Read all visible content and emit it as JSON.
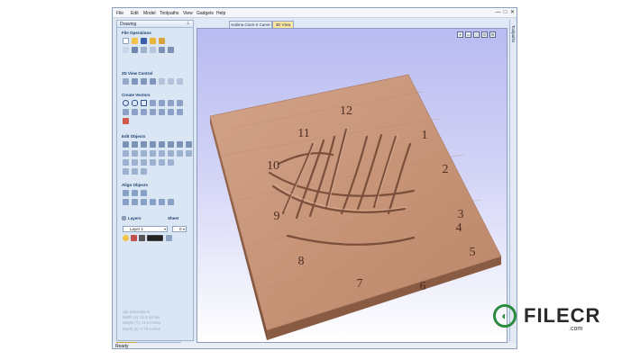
{
  "menu": [
    "File",
    "Edit",
    "Model",
    "Toolpaths",
    "View",
    "Gadgets",
    "Help"
  ],
  "window_controls": [
    "—",
    "□",
    "✕"
  ],
  "panel": {
    "title": "Drawing",
    "pin": "⊥",
    "sections": {
      "file_operations": "File Operations",
      "view_control": "2D View Control",
      "create_vectors": "Create Vectors",
      "edit_objects": "Edit Objects",
      "align_objects": "Align Objects"
    },
    "layers_label": "Layers",
    "sheet_label": "Sheet",
    "layer_select": "Layer 1",
    "sheet_select": "0",
    "job_dims_title": "Job Dimensions",
    "job_width": "Width  (X): 11.8 Inches",
    "job_height": "Height (Y): 11.8 Inches",
    "job_depth": "Depth  (Z): 0.75 Inches"
  },
  "bottom_tabs": [
    "Drawing",
    "Modeling",
    "3D Clipart"
  ],
  "doc_tabs": [
    "Kalima Clock II Carve",
    "3D View"
  ],
  "toolpaths_label": "Toolpaths",
  "status": "Ready",
  "clock_numbers": [
    "12",
    "1",
    "2",
    "3",
    "4",
    "5",
    "6",
    "7",
    "8",
    "9",
    "10",
    "11"
  ],
  "watermark": {
    "brand": "FILECR",
    "sub": ".com"
  },
  "colors": {
    "wood": "#c9977a",
    "wood_dark": "#8a5b43",
    "view_bg_top": "#b9bbf1",
    "accent_tab": "#f6d46a"
  }
}
